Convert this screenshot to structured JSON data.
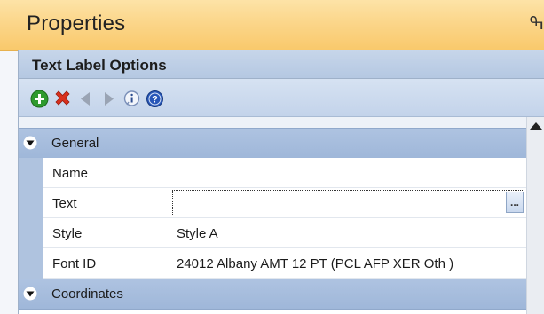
{
  "window": {
    "title": "Properties",
    "pin_glyph": "ߒ"
  },
  "panel": {
    "header": "Text Label Options"
  },
  "toolbar": {
    "buttons": [
      {
        "icon": "add-icon",
        "color": "#2e9a2e"
      },
      {
        "icon": "delete-icon",
        "color": "#d9301d"
      },
      {
        "icon": "previous-icon",
        "color": "#9aa4b4"
      },
      {
        "icon": "next-icon",
        "color": "#9aa4b4"
      },
      {
        "icon": "info-icon",
        "color": "#7a8fb8"
      },
      {
        "icon": "help-icon",
        "color": "#2756b8"
      }
    ]
  },
  "grid": {
    "categories": [
      {
        "label": "General",
        "expanded": true,
        "rows": [
          {
            "name": "Name",
            "value": ""
          },
          {
            "name": "Text",
            "value": "",
            "editing": true,
            "ellipsis": "..."
          },
          {
            "name": "Style",
            "value": "Style A"
          },
          {
            "name": "Font ID",
            "value": "24012 Albany AMT 12 PT (PCL AFP XER Oth )"
          }
        ]
      },
      {
        "label": "Coordinates",
        "expanded": true,
        "rows": []
      }
    ]
  },
  "colors": {
    "title_bar": "#fbd68a",
    "category": "#aec3e1",
    "header": "#b5c8e2"
  }
}
